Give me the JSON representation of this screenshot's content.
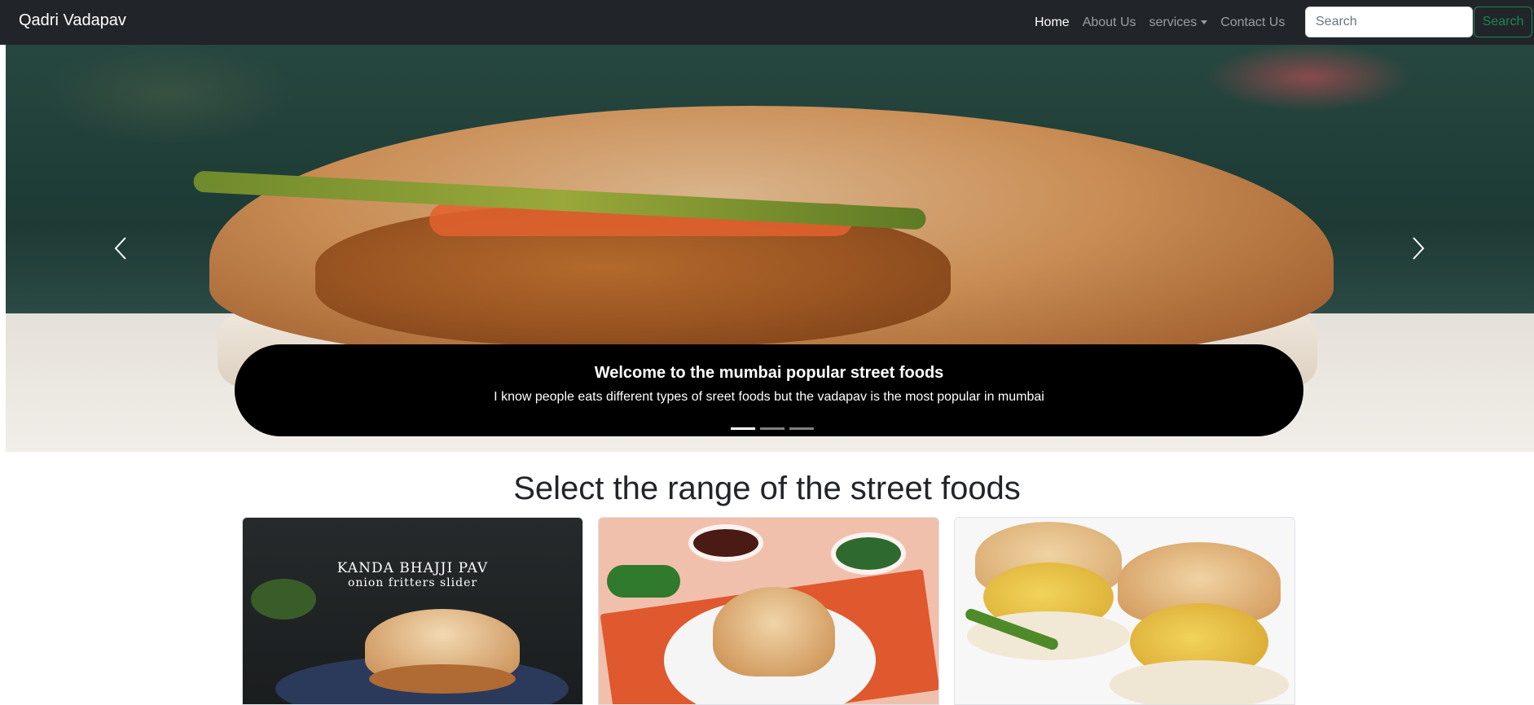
{
  "navbar": {
    "brand": "Qadri Vadapav",
    "links": [
      {
        "label": "Home",
        "active": true
      },
      {
        "label": "About Us",
        "active": false
      },
      {
        "label": "services",
        "active": false,
        "dropdown": true
      },
      {
        "label": "Contact Us",
        "active": false
      }
    ],
    "search": {
      "placeholder": "Search",
      "button_label": "Search"
    }
  },
  "carousel": {
    "caption_title": "Welcome to the mumbai popular street foods",
    "caption_text": "I know people eats different types of sreet foods but the vadapav is the most popular in mumbai",
    "indicators": 3,
    "active_indicator": 0,
    "prev_icon": "chevron-left-icon",
    "next_icon": "chevron-right-icon"
  },
  "section": {
    "title": "Select the range of the street foods",
    "cards": [
      {
        "image_text_1": "KANDA BHAJJI PAV",
        "image_text_2": "onion fritters slider"
      },
      {
        "image_text_1": "",
        "image_text_2": ""
      },
      {
        "image_text_1": "",
        "image_text_2": ""
      }
    ]
  },
  "colors": {
    "navbar_bg": "#212529",
    "search_button": "#198754",
    "caption_bg": "#000000"
  }
}
